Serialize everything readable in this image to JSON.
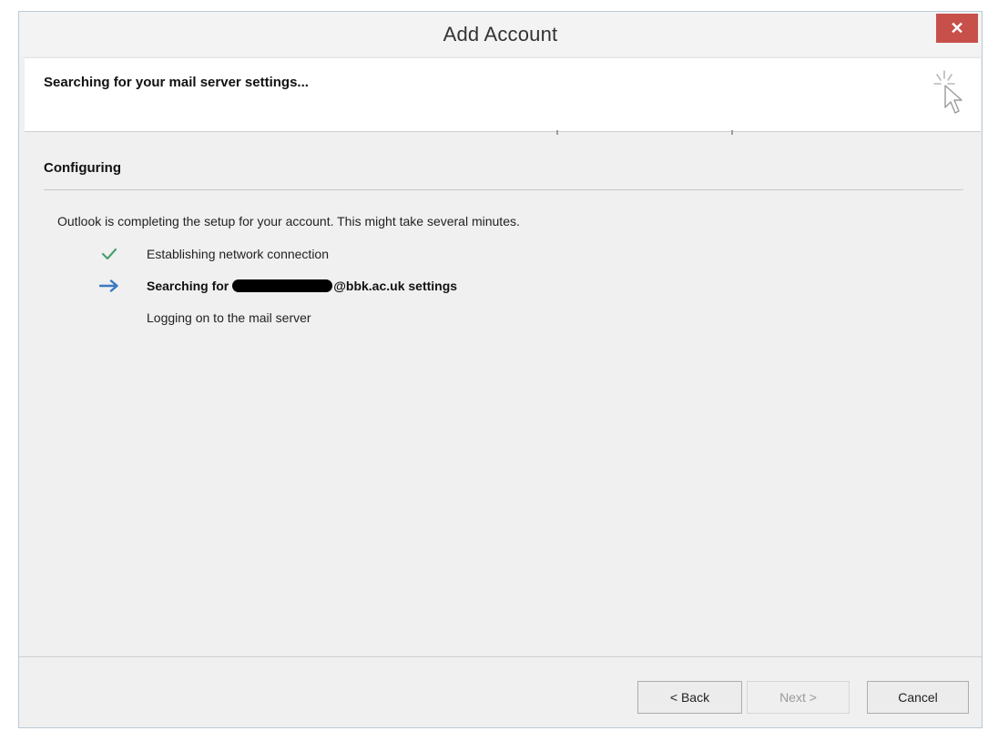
{
  "window": {
    "title": "Add Account",
    "close_label": "✕"
  },
  "header": {
    "status_text": "Searching for your mail server settings..."
  },
  "section": {
    "title": "Configuring",
    "description": "Outlook is completing the setup for your account. This might take several minutes."
  },
  "steps": [
    {
      "state": "done",
      "label": "Establishing network connection"
    },
    {
      "state": "current",
      "label_prefix": "Searching for",
      "label_suffix": "@bbk.ac.uk settings"
    },
    {
      "state": "pending",
      "label": "Logging on to the mail server"
    }
  ],
  "buttons": {
    "back": "< Back",
    "next": "Next >",
    "cancel": "Cancel"
  },
  "colors": {
    "close_button": "#c7504a",
    "check": "#4c9f6f",
    "arrow": "#3b78c4"
  }
}
